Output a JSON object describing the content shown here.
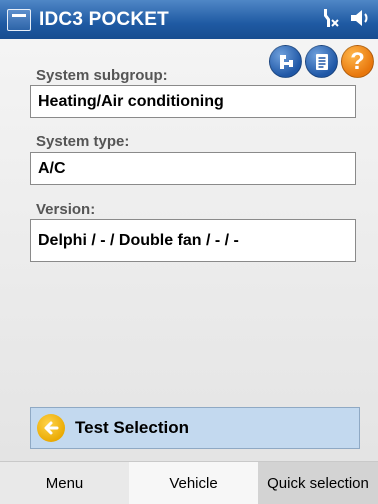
{
  "titlebar": {
    "app_title": "IDC3 POCKET",
    "icons": [
      "app-logo-icon",
      "connectivity-icon",
      "sound-icon"
    ]
  },
  "toolbar": {
    "icons": [
      "connection-icon",
      "document-icon",
      "help-icon"
    ],
    "help_glyph": "?"
  },
  "fields": [
    {
      "label": "System subgroup:",
      "value": "Heating/Air conditioning"
    },
    {
      "label": "System type:",
      "value": "A/C"
    },
    {
      "label": "Version:",
      "value": "Delphi / - / Double fan / - / -"
    }
  ],
  "action": {
    "label": "Test Selection",
    "icon": "arrow-left-icon"
  },
  "bottom_tabs": [
    {
      "label": "Menu"
    },
    {
      "label": "Vehicle"
    },
    {
      "label": "Quick selection"
    }
  ],
  "colors": {
    "titlebar": "#1f5aa3",
    "action_bg": "#c3d9ef",
    "arrow_icon": "#e9a800",
    "help_icon": "#e8770c"
  }
}
